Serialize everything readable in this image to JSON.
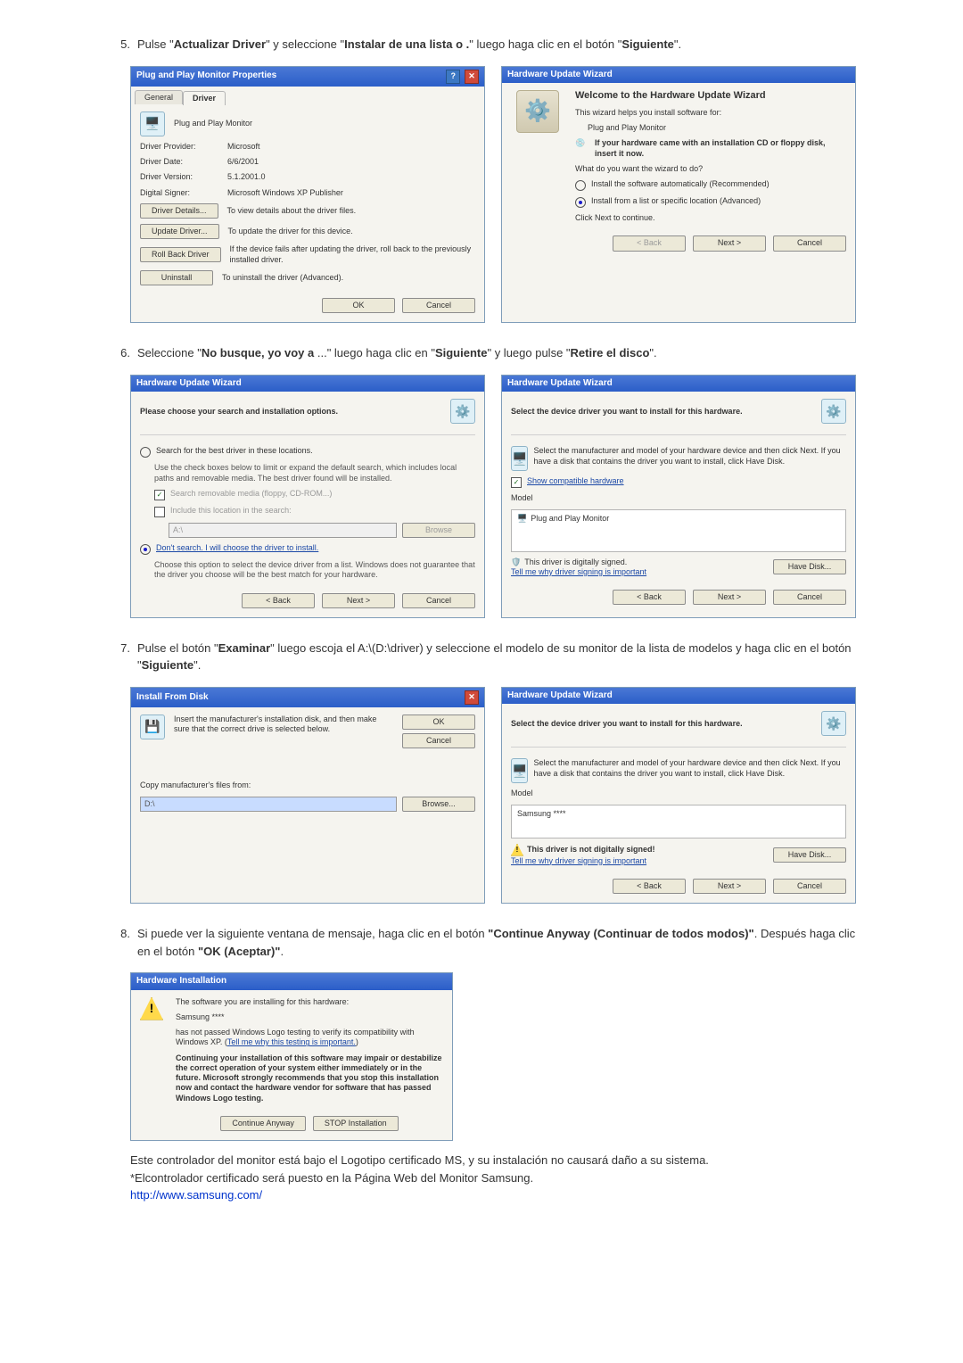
{
  "step5": {
    "num": "5.",
    "t1": "Pulse \"",
    "b1": "Actualizar Driver",
    "t2": "\" y seleccione \"",
    "b2": "Instalar de una lista o .",
    "t3": "\" luego haga clic en el botón \"",
    "b3": "Siguiente",
    "t4": "\"."
  },
  "props": {
    "title": "Plug and Play Monitor Properties",
    "tab_general": "General",
    "tab_driver": "Driver",
    "device": "Plug and Play Monitor",
    "providerK": "Driver Provider:",
    "providerV": "Microsoft",
    "dateK": "Driver Date:",
    "dateV": "6/6/2001",
    "versionK": "Driver Version:",
    "versionV": "5.1.2001.0",
    "signerK": "Digital Signer:",
    "signerV": "Microsoft Windows XP Publisher",
    "details_btn": "Driver Details...",
    "details_txt": "To view details about the driver files.",
    "update_btn": "Update Driver...",
    "update_txt": "To update the driver for this device.",
    "rollback_btn": "Roll Back Driver",
    "rollback_txt": "If the device fails after updating the driver, roll back to the previously installed driver.",
    "uninstall_btn": "Uninstall",
    "uninstall_txt": "To uninstall the driver (Advanced).",
    "ok": "OK",
    "cancel": "Cancel"
  },
  "wiz1": {
    "title": "Hardware Update Wizard",
    "welcome": "Welcome to the Hardware Update Wizard",
    "helps": "This wizard helps you install software for:",
    "device": "Plug and Play Monitor",
    "cd_note": "If your hardware came with an installation CD or floppy disk, insert it now.",
    "prompt": "What do you want the wizard to do?",
    "opt_auto": "Install the software automatically (Recommended)",
    "opt_list": "Install from a list or specific location (Advanced)",
    "click_next": "Click Next to continue.",
    "back": "< Back",
    "next": "Next >",
    "cancel": "Cancel"
  },
  "step6": {
    "num": "6.",
    "t1": "Seleccione \"",
    "b1": "No busque, yo voy a",
    "t2": " ...\" luego haga clic en \"",
    "b2": "Siguiente",
    "t3": "\" y luego pulse \"",
    "b3": "Retire el disco",
    "t4": "\"."
  },
  "wiz2": {
    "title": "Hardware Update Wizard",
    "header": "Please choose your search and installation options.",
    "opt_search": "Search for the best driver in these locations.",
    "search_note": "Use the check boxes below to limit or expand the default search, which includes local paths and removable media. The best driver found will be installed.",
    "chk_media": "Search removable media (floppy, CD-ROM...)",
    "chk_loc": "Include this location in the search:",
    "path": "A:\\",
    "browse": "Browse",
    "opt_dont": "Don't search. I will choose the driver to install.",
    "dont_note": "Choose this option to select the device driver from a list. Windows does not guarantee that the driver you choose will be the best match for your hardware.",
    "back": "< Back",
    "next": "Next >",
    "cancel": "Cancel"
  },
  "wiz3": {
    "title": "Hardware Update Wizard",
    "header": "Select the device driver you want to install for this hardware.",
    "note": "Select the manufacturer and model of your hardware device and then click Next. If you have a disk that contains the driver you want to install, click Have Disk.",
    "show_comp": "Show compatible hardware",
    "model_lbl": "Model",
    "model_val": "Plug and Play Monitor",
    "signed_txt": "This driver is digitally signed.",
    "signed_link": "Tell me why driver signing is important",
    "havedisk": "Have Disk...",
    "back": "< Back",
    "next": "Next >",
    "cancel": "Cancel"
  },
  "step7": {
    "num": "7.",
    "t1": "Pulse el botón \"",
    "b1": "Examinar",
    "t2": "\" luego escoja el A:\\(D:\\driver) y seleccione el modelo de su monitor de la lista de modelos y haga clic en el botón \"",
    "b2": "Siguiente",
    "t3": "\"."
  },
  "install_disk": {
    "title": "Install From Disk",
    "insert": "Insert the manufacturer's installation disk, and then make sure that the correct drive is selected below.",
    "ok": "OK",
    "cancel": "Cancel",
    "copy_from": "Copy manufacturer's files from:",
    "path": "D:\\",
    "browse": "Browse..."
  },
  "wiz4": {
    "title": "Hardware Update Wizard",
    "header": "Select the device driver you want to install for this hardware.",
    "note": "Select the manufacturer and model of your hardware device and then click Next. If you have a disk that contains the driver you want to install, click Have Disk.",
    "model_lbl": "Model",
    "model_val": "Samsung ****",
    "unsigned_txt": "This driver is not digitally signed!",
    "signed_link": "Tell me why driver signing is important",
    "havedisk": "Have Disk...",
    "back": "< Back",
    "next": "Next >",
    "cancel": "Cancel"
  },
  "step8": {
    "num": "8.",
    "t1": "Si puede ver la siguiente ventana de mensaje, haga clic en el botón ",
    "b1": "\"Continue Anyway (Continuar de todos modos)\"",
    "t2": ". Después haga clic en el botón ",
    "b2": "\"OK (Aceptar)\"",
    "t3": "."
  },
  "hwinstall": {
    "title": "Hardware Installation",
    "l1": "The software you are installing for this hardware:",
    "device": "Samsung ****",
    "l2a": "has not passed Windows Logo testing to verify its compatibility with Windows XP. (",
    "l2link": "Tell me why this testing is important.",
    "l2b": ")",
    "bold_block": "Continuing your installation of this software may impair or destabilize the correct operation of your system either immediately or in the future. Microsoft strongly recommends that you stop this installation now and contact the hardware vendor for software that has passed Windows Logo testing.",
    "continue_btn": "Continue Anyway",
    "stop_btn": "STOP Installation"
  },
  "footer": {
    "l1": "Este controlador del monitor está bajo el Logotipo certificado MS, y su instalación no causará daño a su sistema.",
    "l2": "*Elcontrolador certificado será puesto en la Página Web del Monitor Samsung.",
    "link": "http://www.samsung.com/"
  }
}
